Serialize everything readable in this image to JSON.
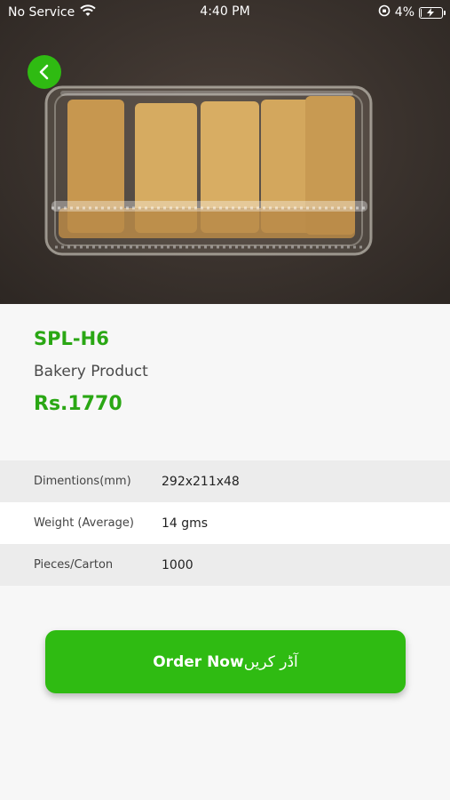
{
  "status_bar": {
    "carrier": "No Service",
    "time": "4:40 PM",
    "battery_percent": "4%",
    "battery_level": 0.04
  },
  "product": {
    "code": "SPL-H6",
    "category": "Bakery Product",
    "price": "Rs.1770"
  },
  "specs": [
    {
      "label": "Dimentions(mm)",
      "value": "292x211x48"
    },
    {
      "label": "Weight (Average)",
      "value": "14 gms"
    },
    {
      "label": "Pieces/Carton",
      "value": "1000"
    }
  ],
  "order_button": {
    "label": "Order Now",
    "label_urdu": "آڈر کریں"
  },
  "colors": {
    "accent": "#2fbb12",
    "price_text": "#2aa714"
  }
}
